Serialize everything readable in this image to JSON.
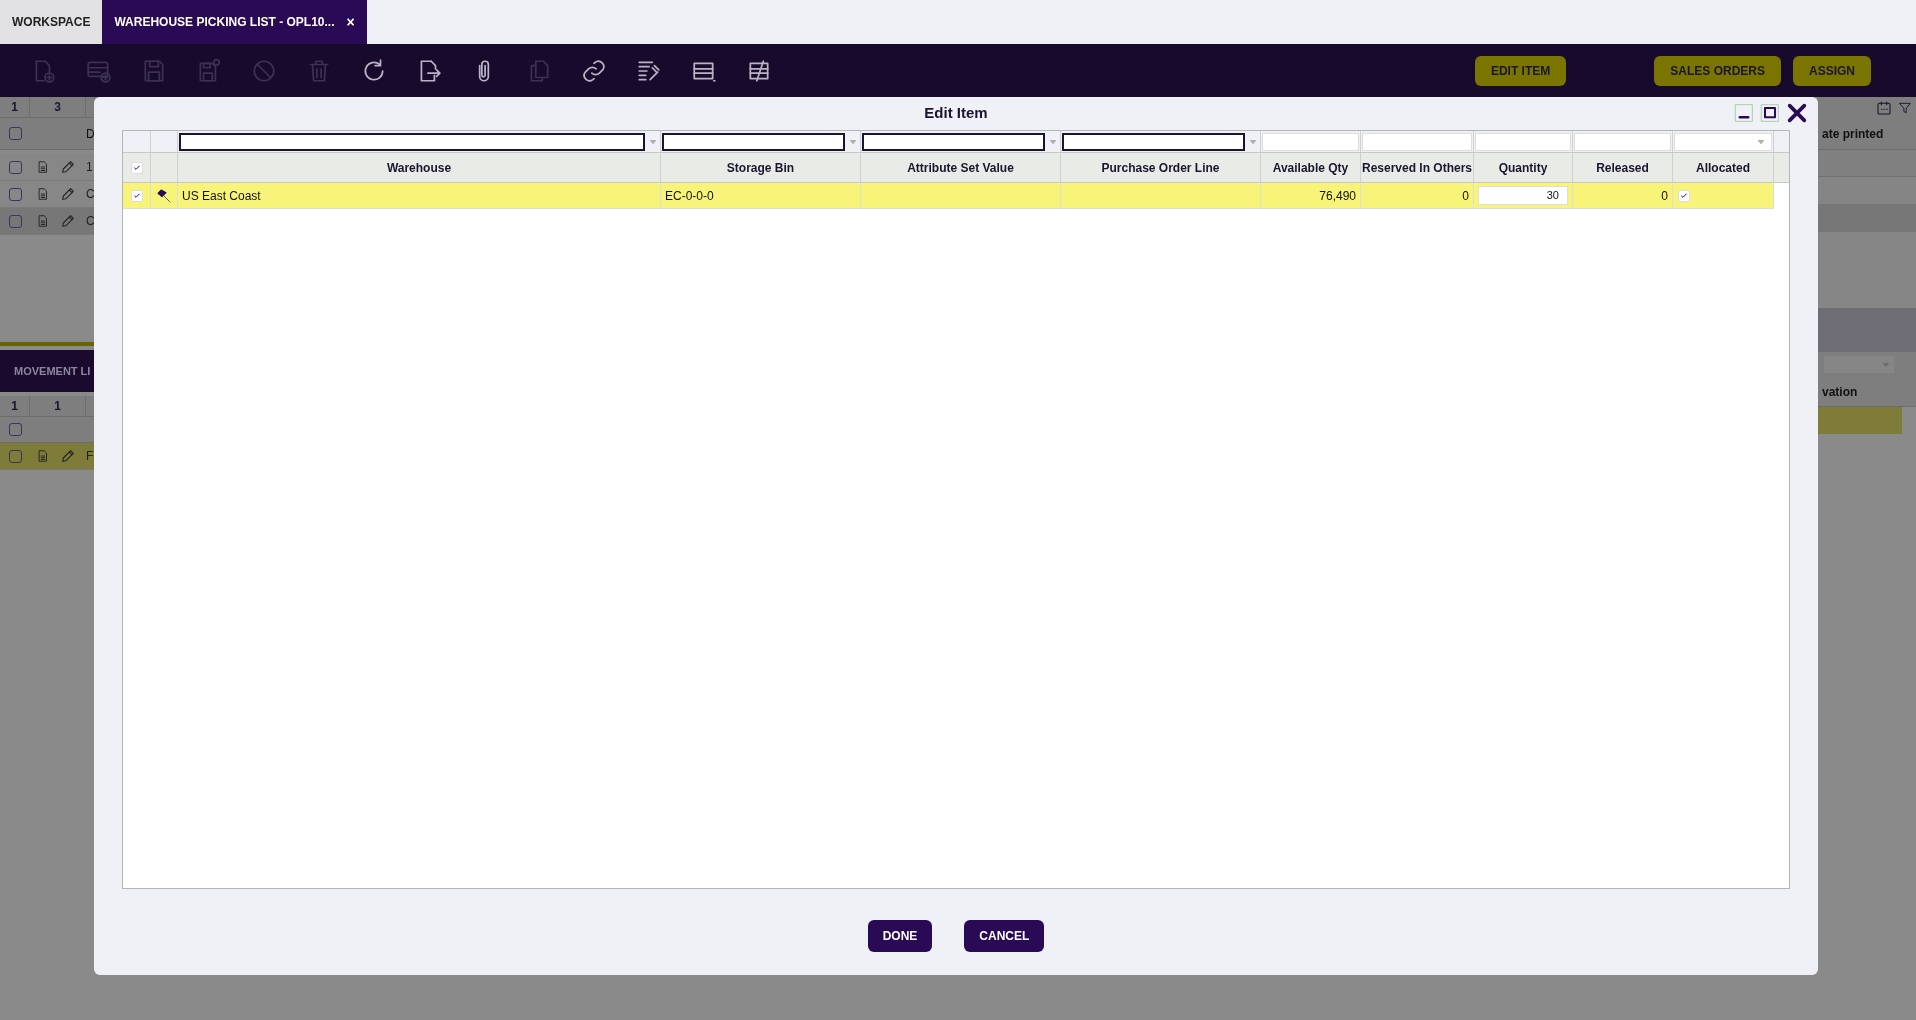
{
  "tabs": [
    {
      "label": "WORKSPACE",
      "selected": false
    },
    {
      "label": "WAREHOUSE PICKING LIST - OPL10...",
      "selected": true,
      "close": "×"
    }
  ],
  "toolbar": {
    "icons": [
      {
        "kind": "new-document",
        "disabled": true
      },
      {
        "kind": "new-row",
        "disabled": true
      },
      {
        "kind": "save",
        "disabled": true
      },
      {
        "kind": "save-close",
        "disabled": true
      },
      {
        "kind": "cancel",
        "disabled": true
      },
      {
        "kind": "delete",
        "disabled": true
      },
      {
        "kind": "refresh",
        "disabled": false
      },
      {
        "kind": "export",
        "disabled": false
      },
      {
        "kind": "attach",
        "disabled": false
      },
      {
        "kind": "copy",
        "disabled": true
      },
      {
        "kind": "link",
        "disabled": false
      },
      {
        "kind": "tools",
        "disabled": false
      },
      {
        "kind": "grid-view",
        "disabled": false
      },
      {
        "kind": "form-view",
        "disabled": false
      }
    ],
    "buttons": [
      "EDIT ITEM",
      "SALES ORDERS",
      "ASSIGN"
    ]
  },
  "background": {
    "upper_select_all": false,
    "lower_select_all": false,
    "upper_counts": [
      "1",
      "3"
    ],
    "upper_column": "D",
    "upper_rows": [
      {
        "text": "1",
        "selected": false
      },
      {
        "text": "C",
        "selected": false
      },
      {
        "text": "C",
        "selected": true
      }
    ],
    "right_column": "ate printed",
    "section_title": "MOVEMENT LI",
    "lower_counts": [
      "1",
      "1"
    ],
    "lower_rows": [
      {
        "text": "F",
        "selected": true
      }
    ],
    "right_lower_column": "vation"
  },
  "dialog": {
    "title": "Edit Item",
    "select_all": true,
    "columns": [
      {
        "label": "Warehouse",
        "kind": "dropdown"
      },
      {
        "label": "Storage Bin",
        "kind": "dropdown"
      },
      {
        "label": "Attribute Set Value",
        "kind": "dropdown"
      },
      {
        "label": "Purchase Order Line",
        "kind": "dropdown"
      },
      {
        "label": "Available Qty",
        "kind": "plain"
      },
      {
        "label": "Reserved In Others",
        "kind": "plain"
      },
      {
        "label": "Quantity",
        "kind": "plain"
      },
      {
        "label": "Released",
        "kind": "plain"
      },
      {
        "label": "Allocated",
        "kind": "select"
      }
    ],
    "rows": [
      {
        "selected": true,
        "pinned": true,
        "warehouse": "US East Coast",
        "storage_bin": "EC-0-0-0",
        "available_qty": "76,490",
        "reserved_in_others": "0",
        "quantity": "30",
        "released": "0",
        "allocated": true
      }
    ],
    "buttons": [
      "DONE",
      "CANCEL"
    ]
  }
}
